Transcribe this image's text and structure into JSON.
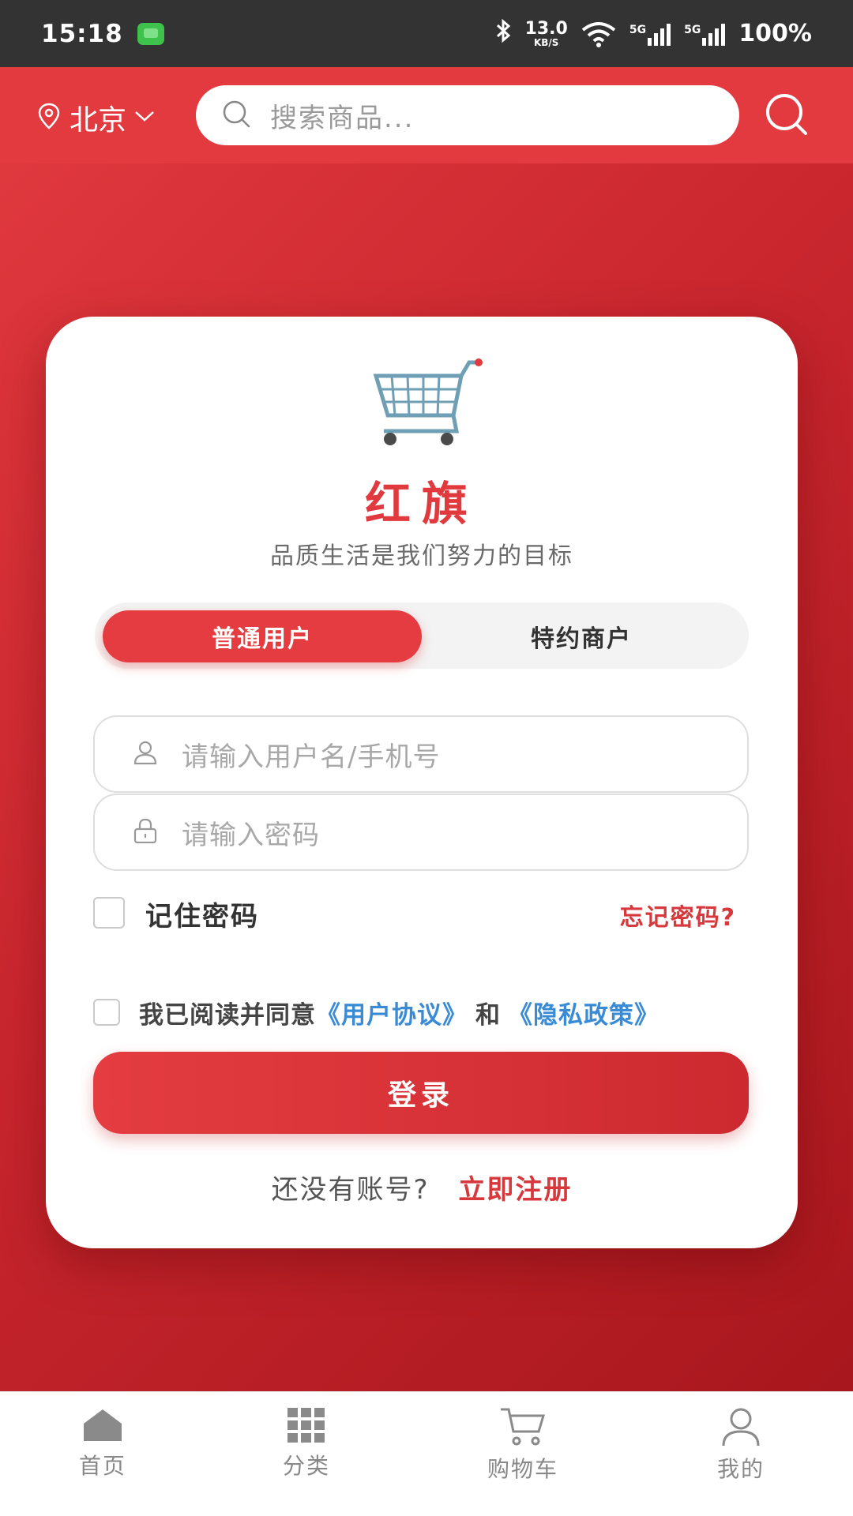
{
  "status_bar": {
    "time": "15:18",
    "net_speed_value": "13.0",
    "net_speed_unit": "KB/S",
    "signal_1_label": "5G",
    "signal_2_label": "5G",
    "battery": "100%",
    "icons": [
      "message-icon",
      "bluetooth-icon",
      "wifi-icon",
      "signal-icon",
      "signal-icon"
    ]
  },
  "header": {
    "city": "北京",
    "search_placeholder": "搜索商品...",
    "icons": [
      "location-pin-icon",
      "chevron-down-icon",
      "search-icon",
      "search-icon"
    ]
  },
  "login_card": {
    "logo_icon": "shopping-cart-icon",
    "title": "红旗",
    "slogan": "品质生活是我们努力的目标",
    "tabs": [
      {
        "label": "普通用户",
        "active": true
      },
      {
        "label": "特约商户",
        "active": false
      }
    ],
    "username_placeholder": "请输入用户名/手机号",
    "password_placeholder": "请输入密码",
    "remember_label": "记住密码",
    "remember_checked": false,
    "forgot_link": "忘记密码?",
    "agreement": {
      "checked": false,
      "prefix": "我已阅读并同意",
      "user_agreement": "《用户协议》",
      "and": "和",
      "privacy_policy": "《隐私政策》"
    },
    "login_button": "登录",
    "register_prompt": "还没有账号?",
    "register_link": "立即注册"
  },
  "bottom_nav": {
    "items": [
      {
        "label": "首页",
        "icon": "home-icon"
      },
      {
        "label": "分类",
        "icon": "grid-icon"
      },
      {
        "label": "购物车",
        "icon": "cart-icon"
      },
      {
        "label": "我的",
        "icon": "user-icon"
      }
    ]
  },
  "colors": {
    "primary_red": "#e43c40",
    "link_blue": "#3a8bd6",
    "status_bar": "#333333"
  }
}
